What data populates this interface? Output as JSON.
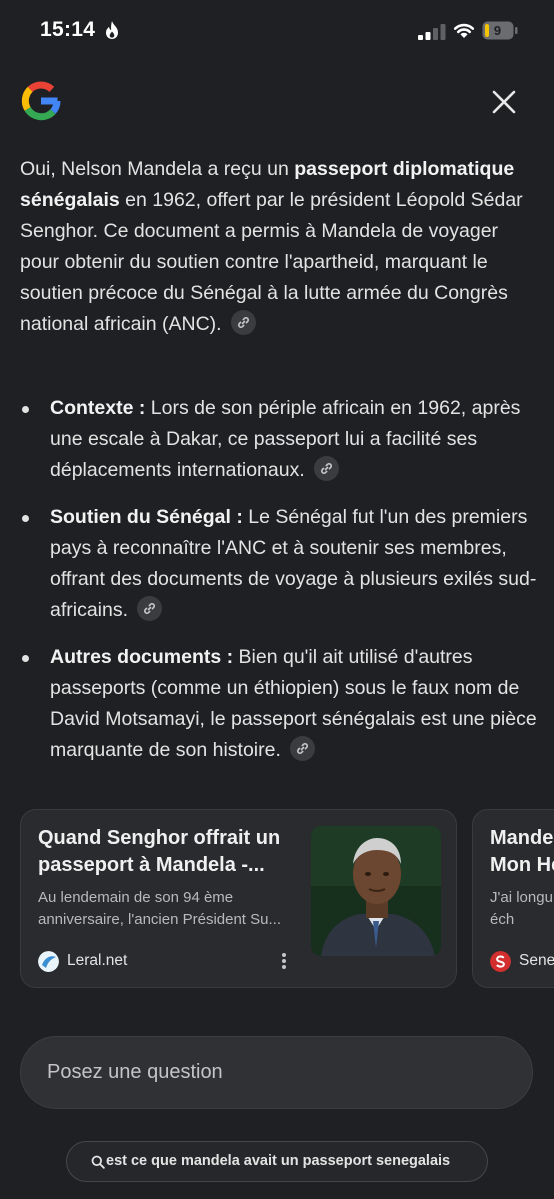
{
  "status_bar": {
    "time": "15:14",
    "battery_level": "9"
  },
  "header": {
    "logo_icon": "google-g-icon",
    "close_icon": "close-icon"
  },
  "answer": {
    "intro_prefix": "Oui, Nelson Mandela a reçu un ",
    "intro_bold": "passeport diplomatique sénégalais",
    "intro_suffix": " en 1962, offert par le président Léopold Sédar Senghor. Ce document a permis à Mandela de voyager pour obtenir du soutien contre l'apartheid, marquant le soutien précoce du Sénégal à la lutte armée du Congrès national africain (ANC).",
    "bullets": [
      {
        "label": "Contexte :",
        "text": " Lors de son périple africain en 1962, après une escale à Dakar, ce passeport lui a facilité ses déplacements internationaux."
      },
      {
        "label": "Soutien du Sénégal :",
        "text": " Le Sénégal fut l'un des premiers pays à reconnaître l'ANC et à soutenir ses membres, offrant des documents de voyage à plusieurs exilés sud-africains."
      },
      {
        "label": "Autres documents :",
        "text": " Bien qu'il ait utilisé d'autres passeports (comme un éthiopien) sous le faux nom de David Motsamayi, le passeport sénégalais est une pièce marquante de son histoire."
      }
    ]
  },
  "cards": [
    {
      "title": "Quand Senghor offrait un passeport à Mandela -...",
      "snippet": "Au lendemain de son 94 ème anniversaire, l'ancien Président Su...",
      "source": "Leral.net"
    },
    {
      "title": "Mande Mon He",
      "snippet": "J'ai longu à cet éch",
      "source": "Sene"
    }
  ],
  "bottom": {
    "ask_placeholder": "Posez une question",
    "query": "est ce que mandela avait un passeport senegalais"
  },
  "colors": {
    "background": "#1f2023",
    "card": "#2a2b2f",
    "text": "#e3e3e3"
  }
}
